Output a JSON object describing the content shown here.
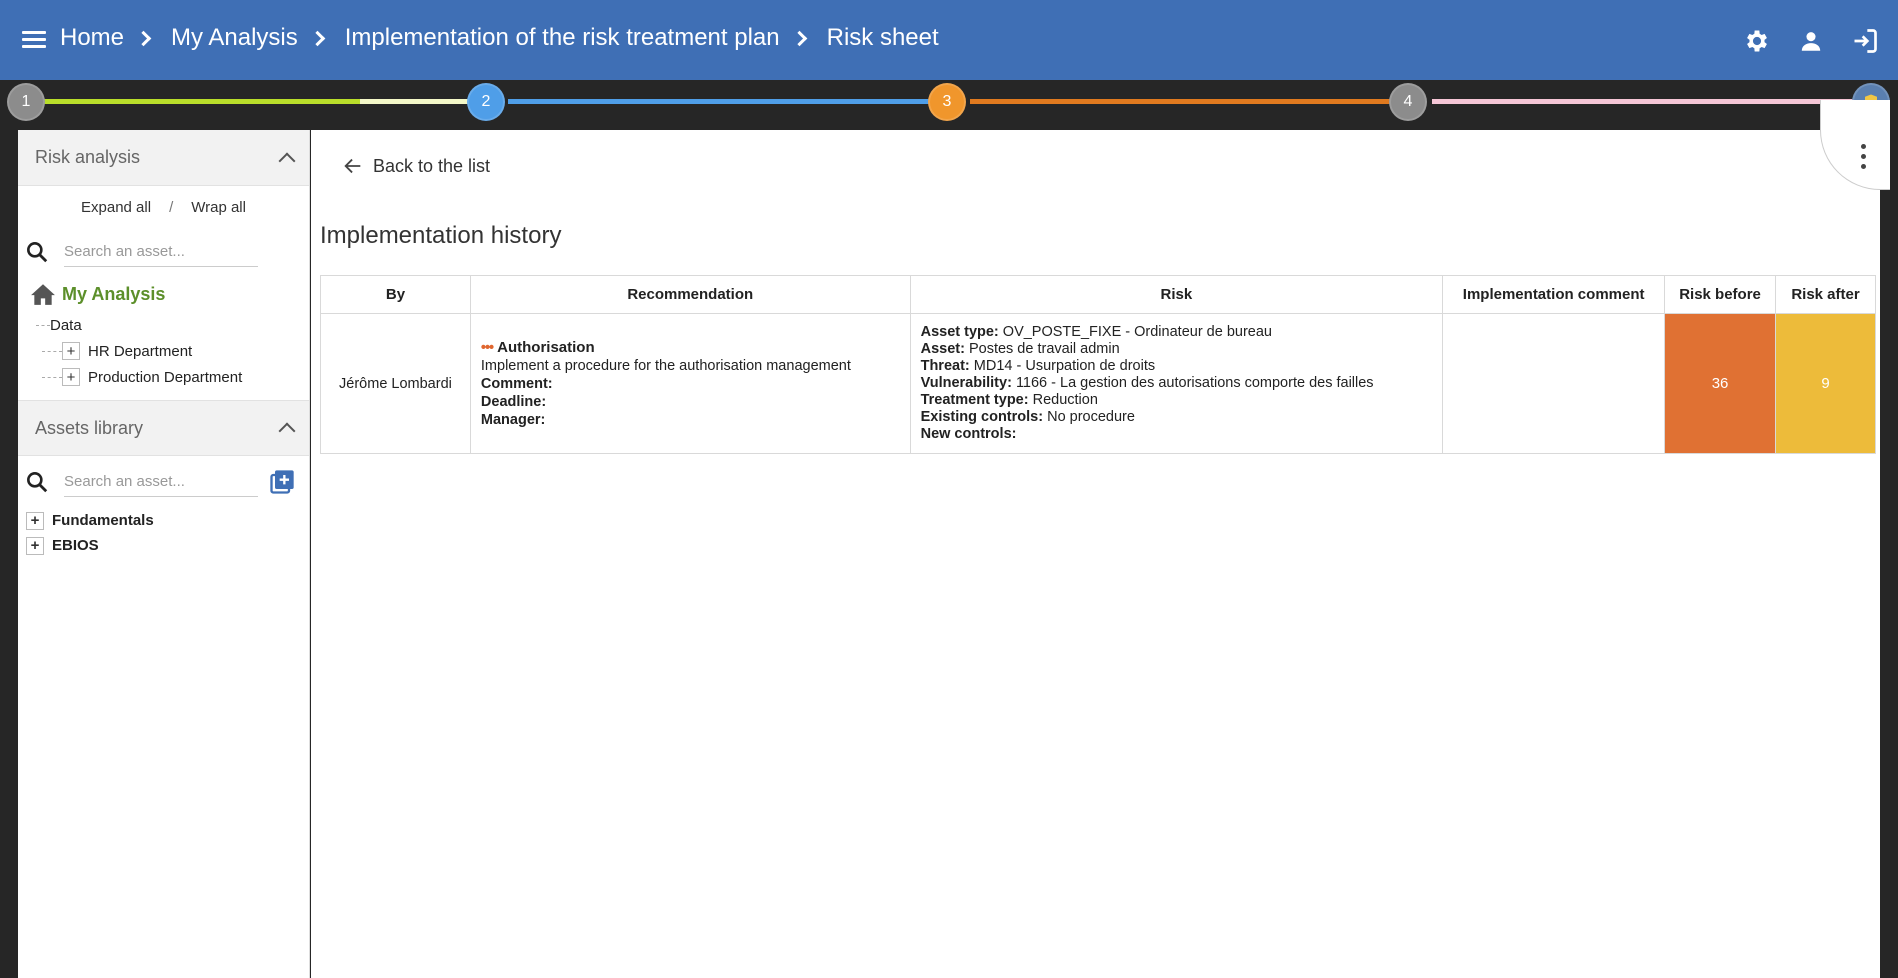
{
  "header": {
    "breadcrumbs": [
      "Home",
      "My Analysis",
      "Implementation of the risk treatment plan",
      "Risk sheet"
    ],
    "icons": [
      "menu-icon",
      "settings-icon",
      "account-icon",
      "logout-icon"
    ]
  },
  "steps": [
    {
      "label": "1",
      "color": "#8c8c8c"
    },
    {
      "label": "2",
      "color": "#4f9ee8"
    },
    {
      "label": "3",
      "color": "#f0962c"
    },
    {
      "label": "4",
      "color": "#8c8c8c"
    },
    {
      "label": "",
      "color": "#5a7fb0"
    }
  ],
  "colors": {
    "topbar": "#3f6fb5",
    "accent_green": "#5c8f2a",
    "risk_before_bg": "#e07133",
    "risk_after_bg": "#edbb3a"
  },
  "sidebar": {
    "risk_analysis": {
      "title": "Risk analysis",
      "expand_all": "Expand all",
      "separator": "/",
      "wrap_all": "Wrap all",
      "search_placeholder": "Search an asset...",
      "root": "My Analysis",
      "items": [
        "Data",
        "HR Department",
        "Production Department"
      ]
    },
    "assets_library": {
      "title": "Assets library",
      "search_placeholder": "Search an asset...",
      "items": [
        "Fundamentals",
        "EBIOS"
      ]
    }
  },
  "main": {
    "back_label": "Back to the list",
    "title": "Implementation history",
    "table": {
      "headers": [
        "By",
        "Recommendation",
        "Risk",
        "Implementation comment",
        "Risk before",
        "Risk after"
      ],
      "row": {
        "by": "Jérôme Lombardi",
        "recommendation": {
          "title": "Authorisation",
          "description": "Implement a procedure for the authorisation management",
          "comment_label": "Comment:",
          "deadline_label": "Deadline:",
          "manager_label": "Manager:"
        },
        "risk": {
          "asset_type_label": "Asset type:",
          "asset_type": "OV_POSTE_FIXE - Ordinateur de bureau",
          "asset_label": "Asset:",
          "asset": "Postes de travail admin",
          "threat_label": "Threat:",
          "threat": "MD14 - Usurpation de droits",
          "vulnerability_label": "Vulnerability:",
          "vulnerability": "1166 - La gestion des autorisations comporte des failles",
          "treatment_type_label": "Treatment type:",
          "treatment_type": "Reduction",
          "existing_controls_label": "Existing controls:",
          "existing_controls": "No procedure",
          "new_controls_label": "New controls:"
        },
        "implementation_comment": "",
        "risk_before": "36",
        "risk_after": "9"
      }
    }
  }
}
